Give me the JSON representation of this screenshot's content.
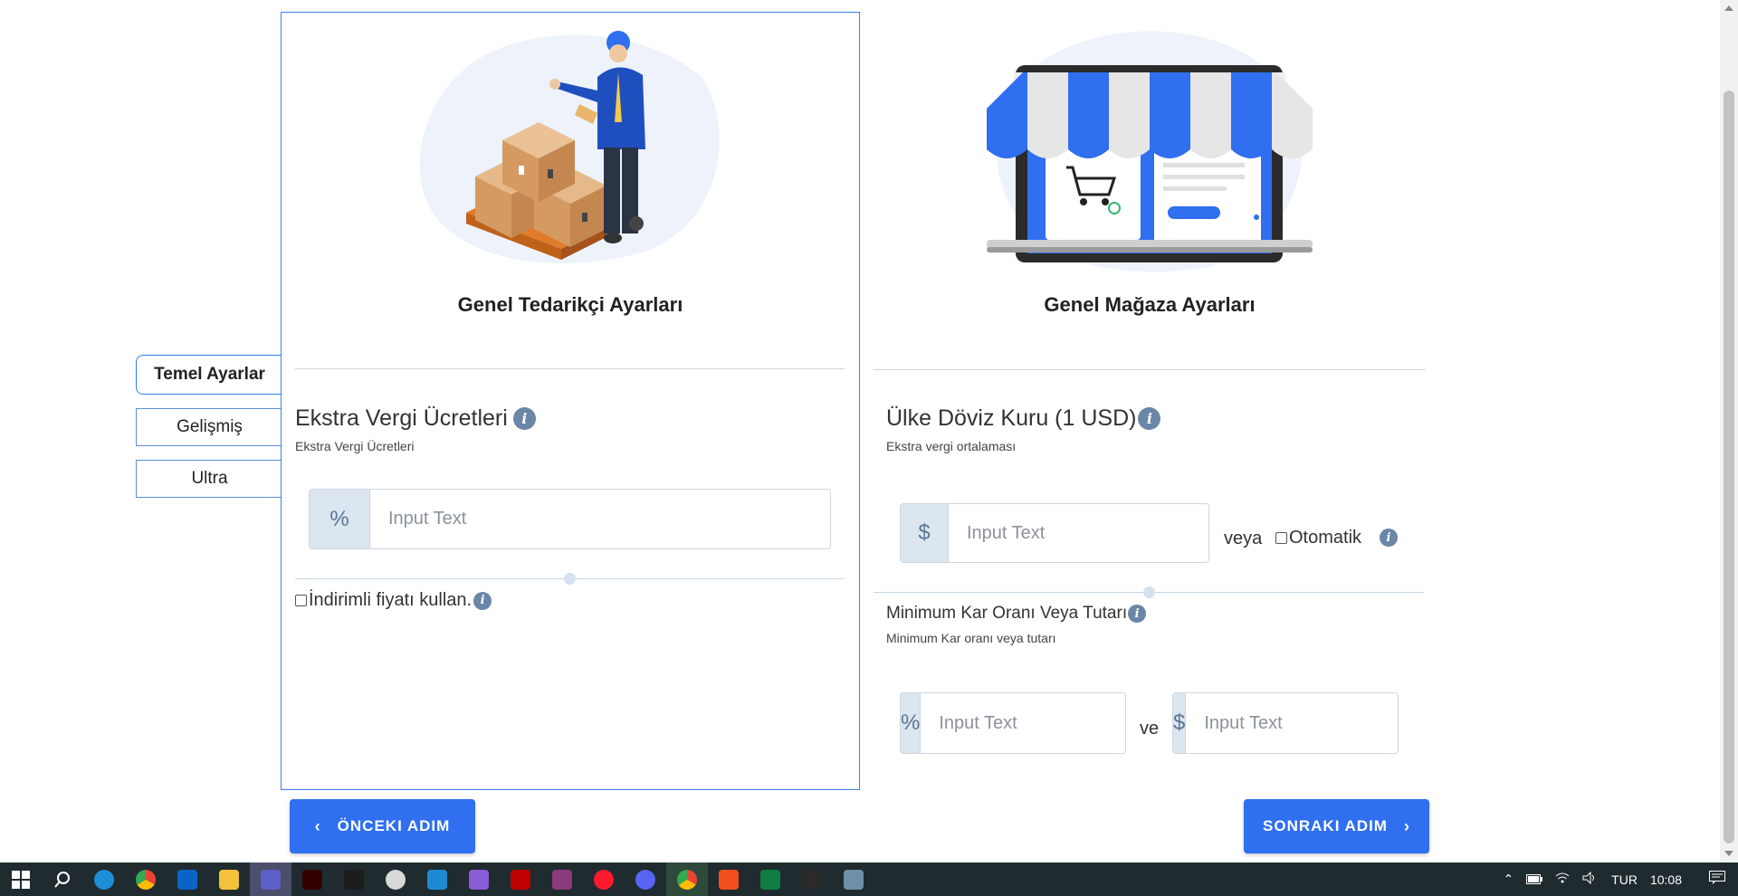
{
  "tabs": [
    {
      "label": "Temel Ayarlar",
      "active": true
    },
    {
      "label": "Gelişmiş",
      "active": false
    },
    {
      "label": "Ultra",
      "active": false
    }
  ],
  "left_panel": {
    "title": "Genel Tedarikçi Ayarları",
    "section_title": "Ekstra Vergi Ücretleri",
    "section_sub": "Ekstra Vergi Ücretleri",
    "input": {
      "addon": "%",
      "placeholder": "Input Text"
    },
    "checkbox_label": "İndirimli fiyatı kullan."
  },
  "right_panel": {
    "title": "Genel Mağaza Ayarları",
    "currency": {
      "title": "Ülke Döviz Kuru (1 USD)",
      "sub": "Ekstra vergi ortalaması",
      "input": {
        "addon": "$",
        "placeholder": "Input Text"
      },
      "or_label": "veya",
      "auto_label": "Otomatik"
    },
    "profit": {
      "title": "Minimum Kar Oranı Veya Tutarı",
      "sub": "Minimum Kar oranı veya tutarı",
      "percent_input": {
        "addon": "%",
        "placeholder": "Input Text"
      },
      "and_label": "ve",
      "amount_input": {
        "addon": "$",
        "placeholder": "Input Text"
      }
    }
  },
  "buttons": {
    "prev": "ÖNCEKI ADIM",
    "next": "SONRAKI ADIM"
  },
  "info_glyph": "i",
  "taskbar": {
    "language": "TUR",
    "time": "10:08"
  },
  "colors": {
    "accent": "#2f6ff0",
    "panel_border": "#3b82f6",
    "addon_bg": "#dbe6f1",
    "taskbar": "#1f2b2f"
  }
}
